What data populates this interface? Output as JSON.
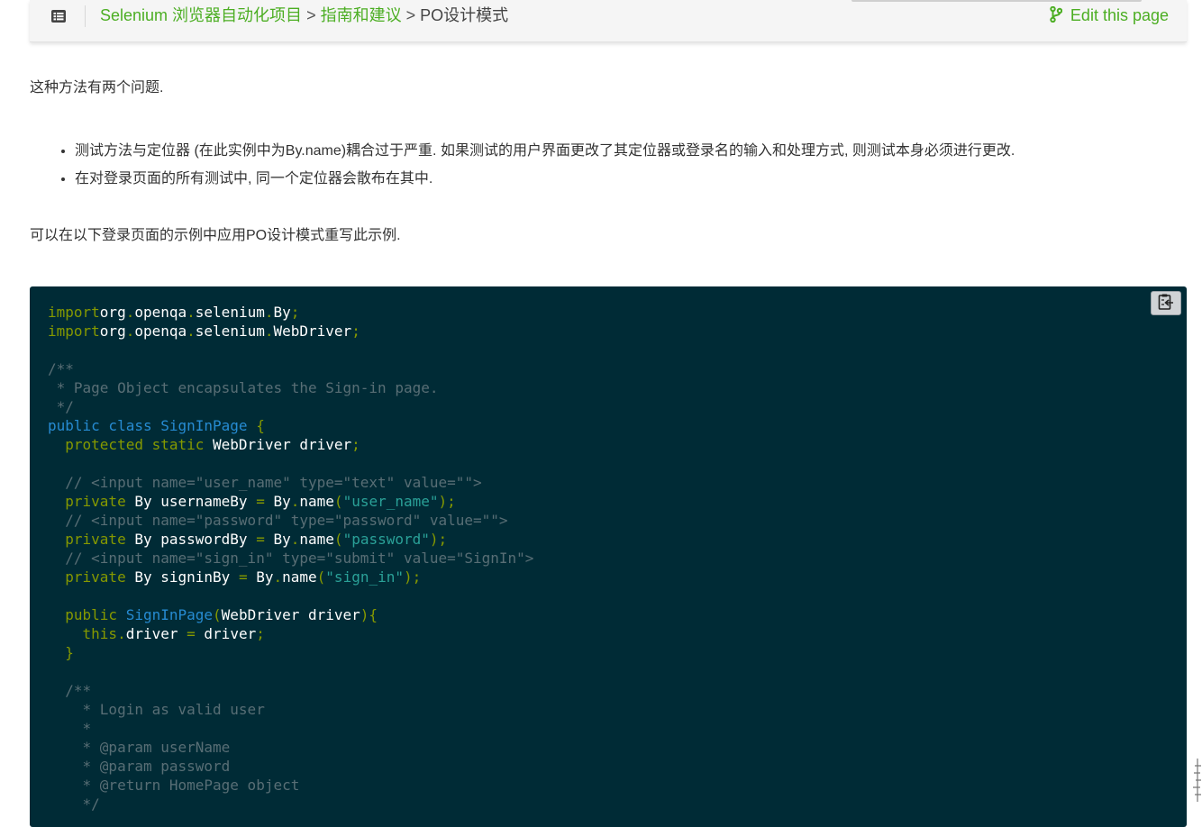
{
  "header": {
    "breadcrumb": [
      {
        "label": "Selenium 浏览器自动化项目",
        "link": true
      },
      {
        "label": "指南和建议",
        "link": true
      },
      {
        "label": "PO设计模式",
        "link": false
      }
    ],
    "separator": ">",
    "edit_label": "Edit this page",
    "accent_color": "#4cae23"
  },
  "icons": {
    "toc": "list-icon",
    "edit": "git-branch-icon",
    "copy": "clipboard-icon"
  },
  "content": {
    "intro": "这种方法有两个问题.",
    "bullets": [
      "测试方法与定位器 (在此实例中为By.name)耦合过于严重. 如果测试的用户界面更改了其定位器或登录名的输入和处理方式, 则测试本身必须进行更改.",
      "在对登录页面的所有测试中, 同一个定位器会散布在其中."
    ],
    "outro": "可以在以下登录页面的示例中应用PO设计模式重写此示例."
  },
  "code": {
    "language": "java",
    "background": "#002b36",
    "lines": [
      [
        [
          "kw",
          "import"
        ],
        [
          "",
          "org"
        ],
        [
          "pun",
          "."
        ],
        [
          "",
          "openqa"
        ],
        [
          "pun",
          "."
        ],
        [
          "",
          "selenium"
        ],
        [
          "pun",
          "."
        ],
        [
          "",
          "By"
        ],
        [
          "pun",
          ";"
        ]
      ],
      [
        [
          "kw",
          "import"
        ],
        [
          "",
          "org"
        ],
        [
          "pun",
          "."
        ],
        [
          "",
          "openqa"
        ],
        [
          "pun",
          "."
        ],
        [
          "",
          "selenium"
        ],
        [
          "pun",
          "."
        ],
        [
          "",
          "WebDriver"
        ],
        [
          "pun",
          ";"
        ]
      ],
      [],
      [
        [
          "cm",
          "/**"
        ]
      ],
      [
        [
          "cm",
          " * Page Object encapsulates the Sign-in page."
        ]
      ],
      [
        [
          "cm",
          " */"
        ]
      ],
      [
        [
          "ty",
          "public class SignInPage"
        ],
        [
          "pun",
          " {"
        ]
      ],
      [
        [
          "",
          "  "
        ],
        [
          "kw",
          "protected static"
        ],
        [
          "",
          " WebDriver driver"
        ],
        [
          "pun",
          ";"
        ]
      ],
      [],
      [
        [
          "cm",
          "  // <input name=\"user_name\" type=\"text\" value=\"\">"
        ]
      ],
      [
        [
          "",
          "  "
        ],
        [
          "kw",
          "private"
        ],
        [
          "",
          " By usernameBy "
        ],
        [
          "pun",
          "="
        ],
        [
          "",
          " By"
        ],
        [
          "pun",
          "."
        ],
        [
          "",
          "name"
        ],
        [
          "pun",
          "("
        ],
        [
          "str",
          "\"user_name\""
        ],
        [
          "pun",
          ");"
        ]
      ],
      [
        [
          "cm",
          "  // <input name=\"password\" type=\"password\" value=\"\">"
        ]
      ],
      [
        [
          "",
          "  "
        ],
        [
          "kw",
          "private"
        ],
        [
          "",
          " By passwordBy "
        ],
        [
          "pun",
          "="
        ],
        [
          "",
          " By"
        ],
        [
          "pun",
          "."
        ],
        [
          "",
          "name"
        ],
        [
          "pun",
          "("
        ],
        [
          "str",
          "\"password\""
        ],
        [
          "pun",
          ");"
        ]
      ],
      [
        [
          "cm",
          "  // <input name=\"sign_in\" type=\"submit\" value=\"SignIn\">"
        ]
      ],
      [
        [
          "",
          "  "
        ],
        [
          "kw",
          "private"
        ],
        [
          "",
          " By signinBy "
        ],
        [
          "pun",
          "="
        ],
        [
          "",
          " By"
        ],
        [
          "pun",
          "."
        ],
        [
          "",
          "name"
        ],
        [
          "pun",
          "("
        ],
        [
          "str",
          "\"sign_in\""
        ],
        [
          "pun",
          ");"
        ]
      ],
      [],
      [
        [
          "",
          "  "
        ],
        [
          "kw",
          "public"
        ],
        [
          "",
          " "
        ],
        [
          "ty",
          "SignInPage"
        ],
        [
          "pun",
          "("
        ],
        [
          "",
          "WebDriver driver"
        ],
        [
          "pun",
          "){"
        ]
      ],
      [
        [
          "",
          "    "
        ],
        [
          "kw",
          "this"
        ],
        [
          "pun",
          "."
        ],
        [
          "",
          "driver "
        ],
        [
          "pun",
          "="
        ],
        [
          "",
          " driver"
        ],
        [
          "pun",
          ";"
        ]
      ],
      [
        [
          "pun",
          "  }"
        ]
      ],
      [],
      [
        [
          "cm",
          "  /**"
        ]
      ],
      [
        [
          "cm",
          "    * Login as valid user"
        ]
      ],
      [
        [
          "cm",
          "    *"
        ]
      ],
      [
        [
          "cm",
          "    * @param userName"
        ]
      ],
      [
        [
          "cm",
          "    * @param password"
        ]
      ],
      [
        [
          "cm",
          "    * @return HomePage object"
        ]
      ],
      [
        [
          "cm",
          "    */"
        ]
      ]
    ]
  }
}
